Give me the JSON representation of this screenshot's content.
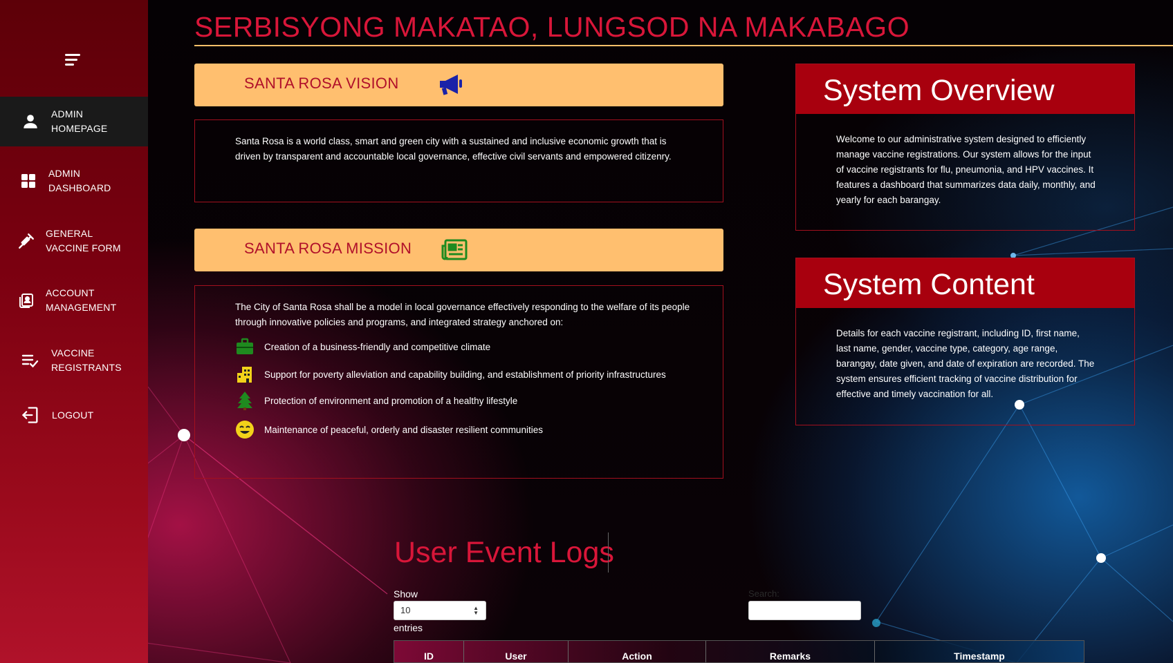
{
  "header": {
    "title": "SERBISYONG MAKATAO, LUNGSOD NA MAKABAGO"
  },
  "sidebar": {
    "items": [
      {
        "label": "ADMIN\nHOMEPAGE",
        "icon": "person-icon",
        "active": true
      },
      {
        "label": "ADMIN\nDASHBOARD",
        "icon": "grid-icon",
        "active": false
      },
      {
        "label": "GENERAL\nVACCINE FORM",
        "icon": "syringe-icon",
        "active": false
      },
      {
        "label": "ACCOUNT\nMANAGEMENT",
        "icon": "contact-book-icon",
        "active": false
      },
      {
        "label": "VACCINE\nREGISTRANTS",
        "icon": "checklist-icon",
        "active": false
      },
      {
        "label": "LOGOUT",
        "icon": "logout-icon",
        "active": false
      }
    ]
  },
  "vision": {
    "heading": "SANTA ROSA VISION",
    "icon": "megaphone-icon",
    "text": "Santa Rosa is a world class, smart and green city with a sustained and inclusive economic growth that is driven by transparent and accountable local governance, effective civil servants and empowered citizenry."
  },
  "mission": {
    "heading": "SANTA ROSA MISSION",
    "icon": "newspaper-icon",
    "intro": "The City of Santa Rosa shall be a model in local governance effectively responding to the welfare of its people through innovative policies and programs, and integrated strategy anchored on:",
    "items": [
      {
        "text": "Creation of a business-friendly and competitive climate",
        "icon": "briefcase-icon"
      },
      {
        "text": "Support for poverty alleviation and capability building, and establishment of priority infrastructures",
        "icon": "building-icon"
      },
      {
        "text": "Protection of environment and promotion of a healthy lifestyle",
        "icon": "tree-icon"
      },
      {
        "text": "Maintenance of peaceful, orderly and disaster resilient communities",
        "icon": "smiley-icon"
      }
    ]
  },
  "overview": {
    "heading": "System Overview",
    "text": "Welcome to our administrative system designed to efficiently manage vaccine registrations. Our system allows for the input of vaccine registrants for flu, pneumonia, and HPV vaccines. It features a dashboard that summarizes data daily, monthly, and yearly for each barangay."
  },
  "content": {
    "heading": "System Content",
    "text": "Details for each vaccine registrant, including ID, first name, last name, gender, vaccine type, category, age range, barangay, date given, and date of expiration are recorded. The system ensures efficient tracking of vaccine distribution for effective and timely vaccination for all."
  },
  "logs": {
    "title": "User Event Logs",
    "show_label": "Show",
    "entries_value": "10",
    "entries_label": "entries",
    "search_label": "Search:",
    "columns": [
      "ID",
      "User",
      "Action",
      "Remarks",
      "Timestamp"
    ]
  },
  "colors": {
    "accent_red": "#d81639",
    "banner": "#ffbf6f",
    "panel_head": "#a8000e"
  }
}
